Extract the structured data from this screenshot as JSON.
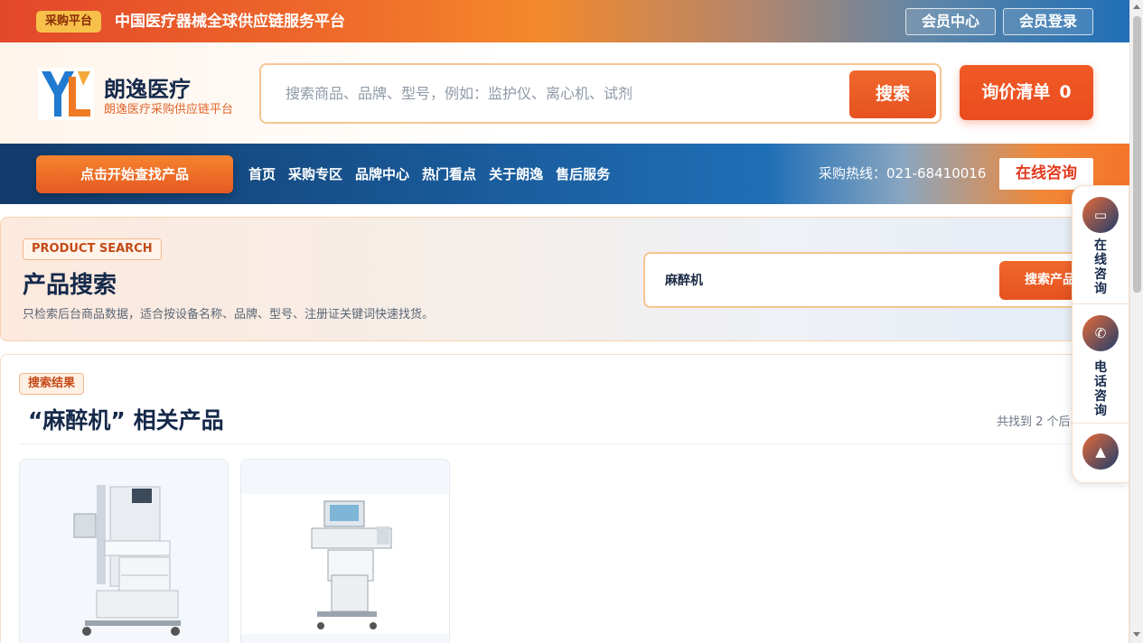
{
  "topbar": {
    "tag": "采购平台",
    "title": "中国医疗器械全球供应链服务平台",
    "member_center": "会员中心",
    "member_login": "会员登录"
  },
  "header": {
    "brand_name": "朗逸医疗",
    "brand_sub": "朗逸医疗采购供应链平台",
    "search_placeholder": "搜索商品、品牌、型号，例如：监护仪、离心机、试剂",
    "search_button": "搜索",
    "inquiry_label": "询价清单",
    "inquiry_count": "0"
  },
  "nav": {
    "cta": "点击开始查找产品",
    "links": [
      "首页",
      "采购专区",
      "品牌中心",
      "热门看点",
      "关于朗逸",
      "售后服务"
    ],
    "hotline": "采购热线：021-68410016",
    "online": "在线咨询"
  },
  "panel": {
    "tag": "PRODUCT SEARCH",
    "title": "产品搜索",
    "desc": "只检索后台商品数据，适合按设备名称、品牌、型号、注册证关键词快速找货。",
    "search_value": "麻醉机",
    "search_button": "搜索产品"
  },
  "results": {
    "tag": "搜索结果",
    "title": "“麻醉机” 相关产品",
    "count": "共找到 2 个后"
  },
  "float_bar": {
    "online_consult": "在线咨询",
    "phone_consult": "电话咨询",
    "online_icon": "chat-icon",
    "phone_icon": "phone-icon",
    "top_icon": "arrow-up-icon"
  },
  "colors": {
    "accent_orange": "#e6521f",
    "navy": "#15294a",
    "nav_blue": "#1f6fb6"
  }
}
